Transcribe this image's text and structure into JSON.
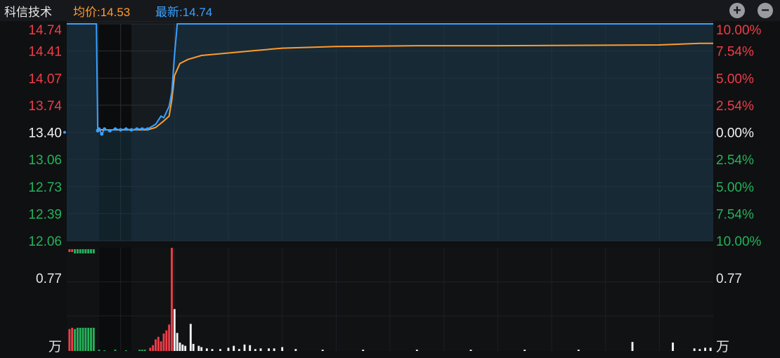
{
  "header": {
    "stock_name": "科信技术",
    "avg_label": "均价:14.53",
    "latest_label": "最新:14.74",
    "zoom_in": "+",
    "zoom_out": "−"
  },
  "colors": {
    "up": "#f03c47",
    "down": "#23b35a",
    "neutral": "#f2f2f2",
    "price_line": "#3aa1ff",
    "avg_line": "#ff9b2d",
    "grid": "#2a3036"
  },
  "chart_data": {
    "type": "line",
    "prev_close": 13.4,
    "y_ticks_left": [
      "14.74",
      "14.41",
      "14.07",
      "13.74",
      "13.40",
      "13.06",
      "12.73",
      "12.39",
      "12.06"
    ],
    "y_ticks_right": [
      "10.00%",
      "7.54%",
      "5.00%",
      "2.54%",
      "0.00%",
      "2.54%",
      "5.00%",
      "7.54%",
      "10.00%"
    ],
    "ylim": [
      12.06,
      14.74
    ],
    "xlim": [
      0,
      240
    ],
    "x_unit": "minutes since 9:30 open",
    "series": [
      {
        "name": "最新",
        "x": [
          0,
          10,
          11,
          11.5,
          12,
          13,
          14,
          16,
          18,
          20,
          22,
          24,
          26,
          28,
          30,
          33,
          35,
          36,
          37,
          38,
          39,
          40,
          41,
          240
        ],
        "y": [
          14.74,
          14.74,
          14.74,
          13.42,
          13.44,
          13.38,
          13.44,
          13.42,
          13.44,
          13.43,
          13.44,
          13.43,
          13.44,
          13.44,
          13.44,
          13.5,
          13.6,
          13.58,
          13.65,
          13.72,
          13.9,
          14.35,
          14.74,
          14.74
        ]
      },
      {
        "name": "均价",
        "x": [
          11,
          15,
          20,
          25,
          30,
          33,
          36,
          38,
          39,
          40,
          42,
          45,
          50,
          60,
          70,
          80,
          100,
          130,
          160,
          220,
          235,
          240
        ],
        "y": [
          13.43,
          13.43,
          13.43,
          13.43,
          13.43,
          13.46,
          13.54,
          13.6,
          13.8,
          14.1,
          14.25,
          14.3,
          14.35,
          14.38,
          14.41,
          14.44,
          14.46,
          14.47,
          14.47,
          14.48,
          14.5,
          14.5
        ]
      }
    ],
    "volume": {
      "unit": "万",
      "tick": "0.77",
      "ylim": [
        0,
        1.6
      ],
      "bars": [
        {
          "x": 1,
          "v": 0.34,
          "dir": "up"
        },
        {
          "x": 2,
          "v": 0.36,
          "dir": "up"
        },
        {
          "x": 3,
          "v": 0.34,
          "dir": "down"
        },
        {
          "x": 4,
          "v": 0.36,
          "dir": "down"
        },
        {
          "x": 5,
          "v": 0.36,
          "dir": "down"
        },
        {
          "x": 6,
          "v": 0.36,
          "dir": "down"
        },
        {
          "x": 7,
          "v": 0.36,
          "dir": "down"
        },
        {
          "x": 8,
          "v": 0.36,
          "dir": "down"
        },
        {
          "x": 9,
          "v": 0.36,
          "dir": "down"
        },
        {
          "x": 10,
          "v": 0.36,
          "dir": "down"
        },
        {
          "x": 12,
          "v": 0.02,
          "dir": "down"
        },
        {
          "x": 14,
          "v": 0.01,
          "dir": "down"
        },
        {
          "x": 18,
          "v": 0.02,
          "dir": "down"
        },
        {
          "x": 22,
          "v": 0.01,
          "dir": "down"
        },
        {
          "x": 27,
          "v": 0.02,
          "dir": "down"
        },
        {
          "x": 28,
          "v": 0.02,
          "dir": "down"
        },
        {
          "x": 29,
          "v": 0.02,
          "dir": "down"
        },
        {
          "x": 31,
          "v": 0.05,
          "dir": "up"
        },
        {
          "x": 32,
          "v": 0.09,
          "dir": "up"
        },
        {
          "x": 33,
          "v": 0.18,
          "dir": "up"
        },
        {
          "x": 34,
          "v": 0.22,
          "dir": "up"
        },
        {
          "x": 35,
          "v": 0.15,
          "dir": "up"
        },
        {
          "x": 36,
          "v": 0.27,
          "dir": "up"
        },
        {
          "x": 37,
          "v": 0.32,
          "dir": "up"
        },
        {
          "x": 38,
          "v": 0.41,
          "dir": "up"
        },
        {
          "x": 39,
          "v": 1.6,
          "dir": "up"
        },
        {
          "x": 40,
          "v": 0.65,
          "dir": "flat"
        },
        {
          "x": 41,
          "v": 0.28,
          "dir": "flat"
        },
        {
          "x": 42,
          "v": 0.13,
          "dir": "flat"
        },
        {
          "x": 43,
          "v": 0.1,
          "dir": "flat"
        },
        {
          "x": 44,
          "v": 0.08,
          "dir": "flat"
        },
        {
          "x": 46,
          "v": 0.42,
          "dir": "flat"
        },
        {
          "x": 47,
          "v": 0.11,
          "dir": "flat"
        },
        {
          "x": 49,
          "v": 0.08,
          "dir": "flat"
        },
        {
          "x": 50,
          "v": 0.06,
          "dir": "flat"
        },
        {
          "x": 52,
          "v": 0.04,
          "dir": "flat"
        },
        {
          "x": 54,
          "v": 0.03,
          "dir": "flat"
        },
        {
          "x": 57,
          "v": 0.03,
          "dir": "flat"
        },
        {
          "x": 60,
          "v": 0.05,
          "dir": "flat"
        },
        {
          "x": 62,
          "v": 0.08,
          "dir": "flat"
        },
        {
          "x": 64,
          "v": 0.03,
          "dir": "flat"
        },
        {
          "x": 66,
          "v": 0.1,
          "dir": "flat"
        },
        {
          "x": 68,
          "v": 0.09,
          "dir": "flat"
        },
        {
          "x": 70,
          "v": 0.03,
          "dir": "flat"
        },
        {
          "x": 72,
          "v": 0.04,
          "dir": "flat"
        },
        {
          "x": 75,
          "v": 0.04,
          "dir": "flat"
        },
        {
          "x": 77,
          "v": 0.04,
          "dir": "flat"
        },
        {
          "x": 80,
          "v": 0.06,
          "dir": "flat"
        },
        {
          "x": 85,
          "v": 0.03,
          "dir": "flat"
        },
        {
          "x": 95,
          "v": 0.02,
          "dir": "flat"
        },
        {
          "x": 110,
          "v": 0.02,
          "dir": "flat"
        },
        {
          "x": 130,
          "v": 0.02,
          "dir": "flat"
        },
        {
          "x": 150,
          "v": 0.02,
          "dir": "flat"
        },
        {
          "x": 170,
          "v": 0.02,
          "dir": "flat"
        },
        {
          "x": 190,
          "v": 0.02,
          "dir": "flat"
        },
        {
          "x": 210,
          "v": 0.14,
          "dir": "flat"
        },
        {
          "x": 225,
          "v": 0.13,
          "dir": "flat"
        },
        {
          "x": 233,
          "v": 0.04,
          "dir": "flat"
        },
        {
          "x": 235,
          "v": 0.03,
          "dir": "flat"
        },
        {
          "x": 237,
          "v": 0.05,
          "dir": "flat"
        },
        {
          "x": 239,
          "v": 0.05,
          "dir": "flat"
        }
      ]
    }
  }
}
